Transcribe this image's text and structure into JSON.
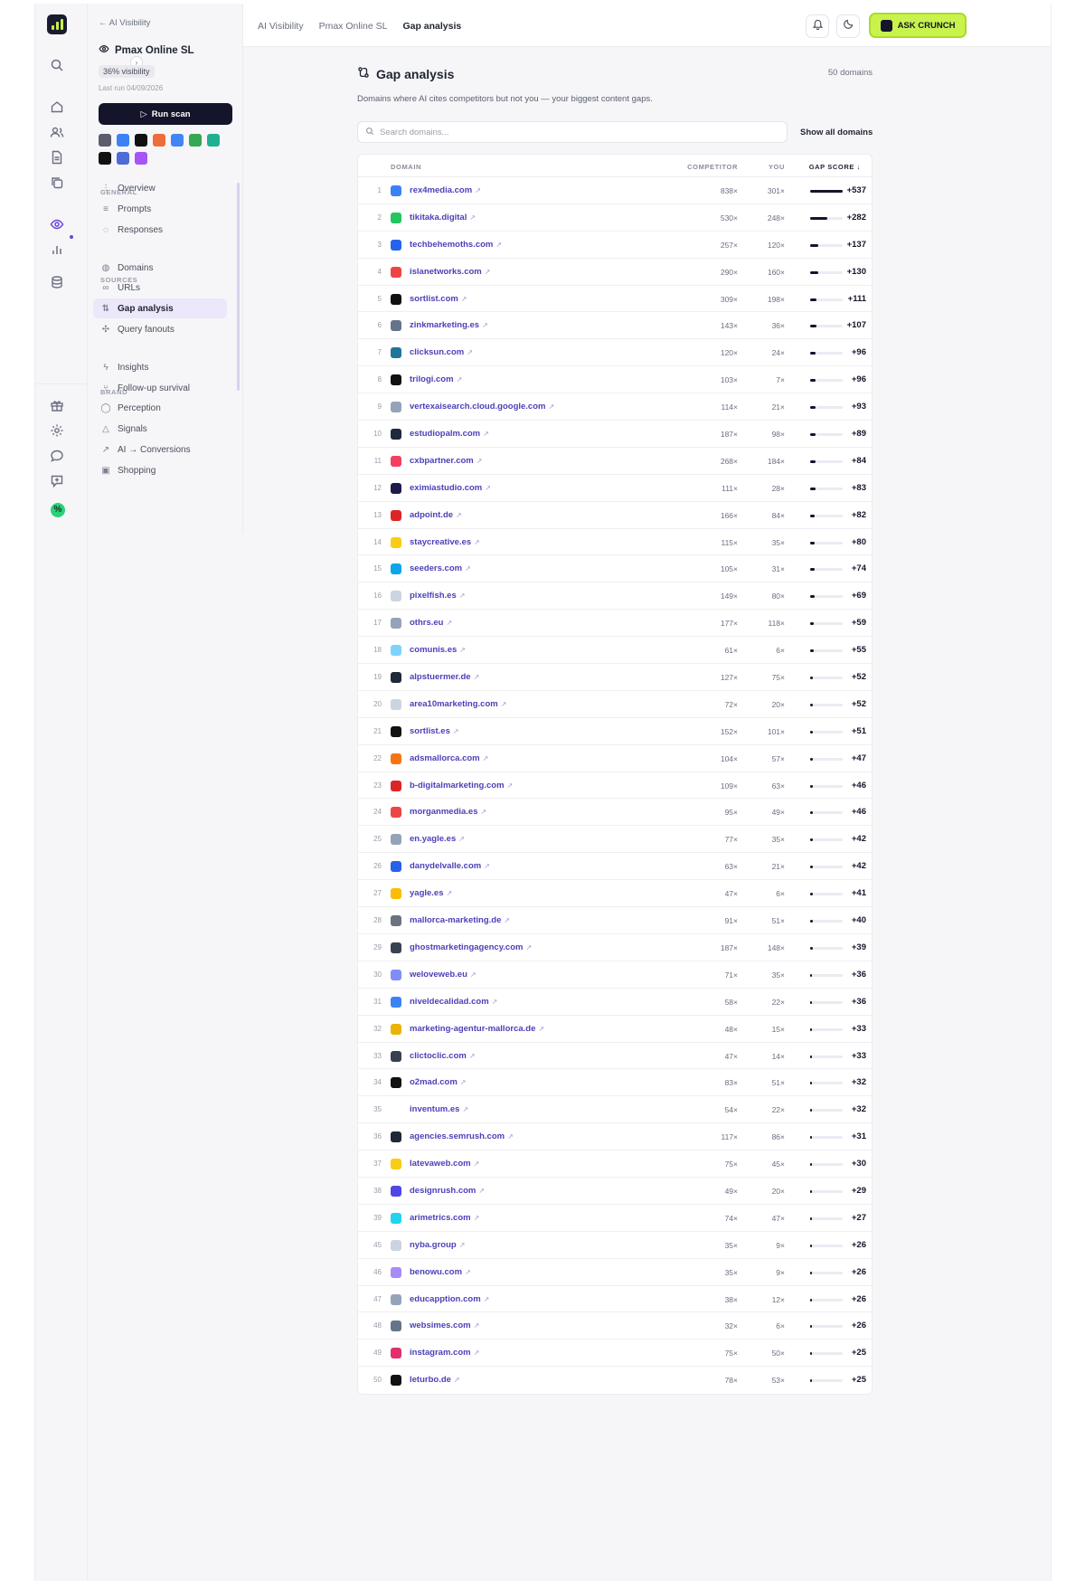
{
  "topbar": {
    "breadcrumbs": [
      "AI Visibility",
      "Pmax Online SL",
      "Gap analysis"
    ],
    "ask_label": "ASK CRUNCH"
  },
  "sidebar": {
    "back_label": "AI Visibility",
    "project_name": "Pmax Online SL",
    "visibility": "36% visibility",
    "last_run": "Last run 04/09/2026",
    "run_scan_label": "Run scan",
    "sections": {
      "general": "GENERAL",
      "sources": "SOURCES",
      "brand": "BRAND"
    },
    "items": [
      {
        "label": "Overview",
        "icon": "bar-chart-icon"
      },
      {
        "label": "Prompts",
        "icon": "list-icon"
      },
      {
        "label": "Responses",
        "icon": "chat-icon"
      },
      {
        "label": "Domains",
        "icon": "globe-icon"
      },
      {
        "label": "URLs",
        "icon": "link-icon"
      },
      {
        "label": "Gap analysis",
        "icon": "gap-icon"
      },
      {
        "label": "Query fanouts",
        "icon": "fanout-icon"
      },
      {
        "label": "Insights",
        "icon": "bolt-icon"
      },
      {
        "label": "Follow-up survival",
        "icon": "branch-icon"
      },
      {
        "label": "Perception",
        "icon": "bubble-icon"
      },
      {
        "label": "Signals",
        "icon": "bell-icon"
      },
      {
        "label": "AI → Conversions",
        "icon": "trend-icon"
      },
      {
        "label": "Shopping",
        "icon": "bag-icon"
      }
    ],
    "engine_colors": [
      "#5c5c6e",
      "#3b82f6",
      "#111111",
      "#ef6c3b",
      "#4285f4",
      "#34a853",
      "#20b08f",
      "#111111",
      "#4f6bd8",
      "#a855f7"
    ]
  },
  "page": {
    "title": "Gap analysis",
    "count": "50 domains",
    "subtitle": "Domains where AI cites competitors but not you — your biggest content gaps.",
    "search_placeholder": "Search domains...",
    "show_all_label": "Show all domains"
  },
  "table": {
    "headers": {
      "domain": "DOMAIN",
      "competitor": "COMPETITOR",
      "you": "YOU",
      "gap": "GAP SCORE ↓"
    },
    "max_gap": 537,
    "rows": [
      {
        "n": "1",
        "domain": "rex4media.com",
        "comp": "838×",
        "you": "301×",
        "gap": "+537",
        "g": 537,
        "color": "#3b82f6"
      },
      {
        "n": "2",
        "domain": "tikitaka.digital",
        "comp": "530×",
        "you": "248×",
        "gap": "+282",
        "g": 282,
        "color": "#22c55e"
      },
      {
        "n": "3",
        "domain": "techbehemoths.com",
        "comp": "257×",
        "you": "120×",
        "gap": "+137",
        "g": 137,
        "color": "#2563eb"
      },
      {
        "n": "4",
        "domain": "islanetworks.com",
        "comp": "290×",
        "you": "160×",
        "gap": "+130",
        "g": 130,
        "color": "#ef4444"
      },
      {
        "n": "5",
        "domain": "sortlist.com",
        "comp": "309×",
        "you": "198×",
        "gap": "+111",
        "g": 111,
        "color": "#111111"
      },
      {
        "n": "6",
        "domain": "zinkmarketing.es",
        "comp": "143×",
        "you": "36×",
        "gap": "+107",
        "g": 107,
        "color": "#64748b"
      },
      {
        "n": "7",
        "domain": "clicksun.com",
        "comp": "120×",
        "you": "24×",
        "gap": "+96",
        "g": 96,
        "color": "#21759b"
      },
      {
        "n": "8",
        "domain": "trilogi.com",
        "comp": "103×",
        "you": "7×",
        "gap": "+96",
        "g": 96,
        "color": "#111111"
      },
      {
        "n": "9",
        "domain": "vertexaisearch.cloud.google.com",
        "comp": "114×",
        "you": "21×",
        "gap": "+93",
        "g": 93,
        "color": "#94a3b8"
      },
      {
        "n": "10",
        "domain": "estudiopalm.com",
        "comp": "187×",
        "you": "98×",
        "gap": "+89",
        "g": 89,
        "color": "#1e293b"
      },
      {
        "n": "11",
        "domain": "cxbpartner.com",
        "comp": "268×",
        "you": "184×",
        "gap": "+84",
        "g": 84,
        "color": "#f43f5e"
      },
      {
        "n": "12",
        "domain": "eximiastudio.com",
        "comp": "111×",
        "you": "28×",
        "gap": "+83",
        "g": 83,
        "color": "#1e1b4b"
      },
      {
        "n": "13",
        "domain": "adpoint.de",
        "comp": "166×",
        "you": "84×",
        "gap": "+82",
        "g": 82,
        "color": "#dc2626"
      },
      {
        "n": "14",
        "domain": "staycreative.es",
        "comp": "115×",
        "you": "35×",
        "gap": "+80",
        "g": 80,
        "color": "#facc15"
      },
      {
        "n": "15",
        "domain": "seeders.com",
        "comp": "105×",
        "you": "31×",
        "gap": "+74",
        "g": 74,
        "color": "#0ea5e9"
      },
      {
        "n": "16",
        "domain": "pixelfish.es",
        "comp": "149×",
        "you": "80×",
        "gap": "+69",
        "g": 69,
        "color": "#cbd5e1"
      },
      {
        "n": "17",
        "domain": "othrs.eu",
        "comp": "177×",
        "you": "118×",
        "gap": "+59",
        "g": 59,
        "color": "#94a3b8"
      },
      {
        "n": "18",
        "domain": "comunis.es",
        "comp": "61×",
        "you": "6×",
        "gap": "+55",
        "g": 55,
        "color": "#7dd3fc"
      },
      {
        "n": "19",
        "domain": "alpstuermer.de",
        "comp": "127×",
        "you": "75×",
        "gap": "+52",
        "g": 52,
        "color": "#1f2937"
      },
      {
        "n": "20",
        "domain": "area10marketing.com",
        "comp": "72×",
        "you": "20×",
        "gap": "+52",
        "g": 52,
        "color": "#cbd5e1"
      },
      {
        "n": "21",
        "domain": "sortlist.es",
        "comp": "152×",
        "you": "101×",
        "gap": "+51",
        "g": 51,
        "color": "#111111"
      },
      {
        "n": "22",
        "domain": "adsmallorca.com",
        "comp": "104×",
        "you": "57×",
        "gap": "+47",
        "g": 47,
        "color": "#f97316"
      },
      {
        "n": "23",
        "domain": "b-digitalmarketing.com",
        "comp": "109×",
        "you": "63×",
        "gap": "+46",
        "g": 46,
        "color": "#dc2626"
      },
      {
        "n": "24",
        "domain": "morganmedia.es",
        "comp": "95×",
        "you": "49×",
        "gap": "+46",
        "g": 46,
        "color": "#ef4444"
      },
      {
        "n": "25",
        "domain": "en.yagle.es",
        "comp": "77×",
        "you": "35×",
        "gap": "+42",
        "g": 42,
        "color": "#94a3b8"
      },
      {
        "n": "26",
        "domain": "danydelvalle.com",
        "comp": "63×",
        "you": "21×",
        "gap": "+42",
        "g": 42,
        "color": "#2563eb"
      },
      {
        "n": "27",
        "domain": "yagle.es",
        "comp": "47×",
        "you": "6×",
        "gap": "+41",
        "g": 41,
        "color": "#fbbc05"
      },
      {
        "n": "28",
        "domain": "mallorca-marketing.de",
        "comp": "91×",
        "you": "51×",
        "gap": "+40",
        "g": 40,
        "color": "#6b7280"
      },
      {
        "n": "29",
        "domain": "ghostmarketingagency.com",
        "comp": "187×",
        "you": "148×",
        "gap": "+39",
        "g": 39,
        "color": "#374151"
      },
      {
        "n": "30",
        "domain": "weloveweb.eu",
        "comp": "71×",
        "you": "35×",
        "gap": "+36",
        "g": 36,
        "color": "#818cf8"
      },
      {
        "n": "31",
        "domain": "niveldecalidad.com",
        "comp": "58×",
        "you": "22×",
        "gap": "+36",
        "g": 36,
        "color": "#3b82f6"
      },
      {
        "n": "32",
        "domain": "marketing-agentur-mallorca.de",
        "comp": "48×",
        "you": "15×",
        "gap": "+33",
        "g": 33,
        "color": "#eab308"
      },
      {
        "n": "33",
        "domain": "clictoclic.com",
        "comp": "47×",
        "you": "14×",
        "gap": "+33",
        "g": 33,
        "color": "#374151"
      },
      {
        "n": "34",
        "domain": "o2mad.com",
        "comp": "83×",
        "you": "51×",
        "gap": "+32",
        "g": 32,
        "color": "#111111"
      },
      {
        "n": "35",
        "domain": "inventum.es",
        "comp": "54×",
        "you": "22×",
        "gap": "+32",
        "g": 32,
        "color": "#ffffff"
      },
      {
        "n": "36",
        "domain": "agencies.semrush.com",
        "comp": "117×",
        "you": "86×",
        "gap": "+31",
        "g": 31,
        "color": "#1f2937"
      },
      {
        "n": "37",
        "domain": "latevaweb.com",
        "comp": "75×",
        "you": "45×",
        "gap": "+30",
        "g": 30,
        "color": "#facc15"
      },
      {
        "n": "38",
        "domain": "designrush.com",
        "comp": "49×",
        "you": "20×",
        "gap": "+29",
        "g": 29,
        "color": "#4f46e5"
      },
      {
        "n": "39",
        "domain": "arimetrics.com",
        "comp": "74×",
        "you": "47×",
        "gap": "+27",
        "g": 27,
        "color": "#22d3ee"
      },
      {
        "n": "45",
        "domain": "nyba.group",
        "comp": "35×",
        "you": "9×",
        "gap": "+26",
        "g": 26,
        "color": "#cbd5e1"
      },
      {
        "n": "46",
        "domain": "benowu.com",
        "comp": "35×",
        "you": "9×",
        "gap": "+26",
        "g": 26,
        "color": "#a78bfa"
      },
      {
        "n": "47",
        "domain": "educapption.com",
        "comp": "38×",
        "you": "12×",
        "gap": "+26",
        "g": 26,
        "color": "#94a3b8"
      },
      {
        "n": "48",
        "domain": "websimes.com",
        "comp": "32×",
        "you": "6×",
        "gap": "+26",
        "g": 26,
        "color": "#64748b"
      },
      {
        "n": "49",
        "domain": "instagram.com",
        "comp": "75×",
        "you": "50×",
        "gap": "+25",
        "g": 25,
        "color": "#e1306c"
      },
      {
        "n": "50",
        "domain": "leturbo.de",
        "comp": "78×",
        "you": "53×",
        "gap": "+25",
        "g": 25,
        "color": "#111111"
      }
    ]
  }
}
